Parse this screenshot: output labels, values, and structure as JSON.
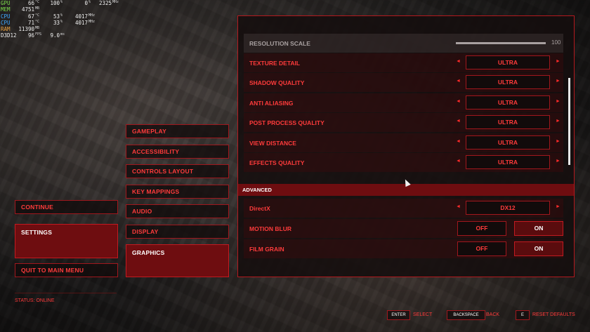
{
  "osd": {
    "rows": [
      {
        "label": "GPU",
        "label_color": "#7cdc4c",
        "v1": "66",
        "u1": "°C",
        "v2": "100",
        "u2": "%",
        "v3": "0",
        "u3": "%",
        "v4": "2325",
        "u4": "MHz"
      },
      {
        "label": "MEM",
        "label_color": "#7cdc4c",
        "v1": "4751",
        "u1": "MB",
        "v2": "",
        "u2": "",
        "v3": "",
        "u3": "",
        "v4": "",
        "u4": ""
      },
      {
        "label": "CPU",
        "label_color": "#3fa8ff",
        "v1": "67",
        "u1": "°C",
        "v2": "53",
        "u2": "%",
        "v3": "4017",
        "u3": "MHz",
        "v4": "",
        "u4": ""
      },
      {
        "label": "CPU",
        "label_color": "#3fa8ff",
        "v1": "71",
        "u1": "°C",
        "v2": "33",
        "u2": "%",
        "v3": "4017",
        "u3": "MHz",
        "v4": "",
        "u4": ""
      },
      {
        "label": "RAM",
        "label_color": "#e8a040",
        "v1": "11390",
        "u1": "MB",
        "v2": "",
        "u2": "",
        "v3": "",
        "u3": "",
        "v4": "",
        "u4": ""
      },
      {
        "label": "D3D12",
        "label_color": "#f0f0f0",
        "v1": "96",
        "u1": "FPS",
        "v2": "9.0",
        "u2": "ms",
        "v3": "",
        "u3": "",
        "v4": "",
        "u4": ""
      }
    ]
  },
  "main_menu": {
    "continue": "CONTINUE",
    "settings": "SETTINGS",
    "quit": "QUIT TO MAIN MENU"
  },
  "status": "STATUS: ONLINE",
  "categories": [
    "GAMEPLAY",
    "ACCESSIBILITY",
    "CONTROLS LAYOUT",
    "KEY MAPPINGS",
    "AUDIO",
    "DISPLAY",
    "GRAPHICS"
  ],
  "selected_category": "GRAPHICS",
  "graphics": {
    "resolution_scale": {
      "label": "RESOLUTION SCALE",
      "value": "100",
      "fraction": 1.0
    },
    "options": [
      {
        "label": "TEXTURE DETAIL",
        "value": "ULTRA"
      },
      {
        "label": "SHADOW QUALITY",
        "value": "ULTRA"
      },
      {
        "label": "ANTI ALIASING",
        "value": "ULTRA"
      },
      {
        "label": "POST PROCESS QUALITY",
        "value": "ULTRA"
      },
      {
        "label": "VIEW DISTANCE",
        "value": "ULTRA"
      },
      {
        "label": "EFFECTS QUALITY",
        "value": "ULTRA"
      }
    ],
    "advanced_header": "ADVANCED",
    "directx": {
      "label": "DirectX",
      "value": "DX12"
    },
    "toggles": [
      {
        "label": "MOTION BLUR",
        "off": "OFF",
        "on": "ON",
        "selected": "ON"
      },
      {
        "label": "FILM GRAIN",
        "off": "OFF",
        "on": "ON",
        "selected": "ON"
      }
    ],
    "arrow_left": "◄",
    "arrow_right": "►"
  },
  "prompts": [
    {
      "key": "ENTER",
      "label": "SELECT"
    },
    {
      "key": "BACKSPACE",
      "label": "BACK"
    },
    {
      "key": "E",
      "label": "RESET DEFAULTS"
    }
  ],
  "colors": {
    "accent": "#ff3b3b",
    "selected_bg": "#6e0d10",
    "border": "#a0171d"
  }
}
